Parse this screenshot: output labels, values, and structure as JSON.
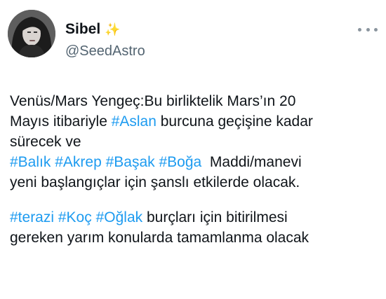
{
  "user": {
    "display_name": "Sibel",
    "emoji": "✨",
    "handle": "@SeedAstro"
  },
  "menu": {
    "icon": "more-horizontal-icon"
  },
  "tweet": {
    "line1": "Venüs/Mars Yengeç:Bu birliktelik Mars’ın 20",
    "line2_pre": "Mayıs itibariyle ",
    "tag_aslan": "#Aslan",
    "line2_post": " burcuna geçişine kadar",
    "line3": "sürecek ve",
    "tag_balik": "#Balık",
    "tag_akrep": "#Akrep",
    "tag_basak": "#Başak",
    "tag_boga": "#Boğa",
    "line4_post": "  Maddi/manevi",
    "line5": "yeni başlangıçlar için şanslı etkilerde olacak.",
    "tag_terazi": "#terazi",
    "tag_koc": "#Koç",
    "tag_oglak": "#Oğlak",
    "line6_post": " burçları için bitirilmesi",
    "line7": "gereken yarım konularda tamamlanma olacak"
  },
  "colors": {
    "hashtag": "#1d9bf0",
    "text": "#0f1419",
    "handle": "#536471"
  }
}
